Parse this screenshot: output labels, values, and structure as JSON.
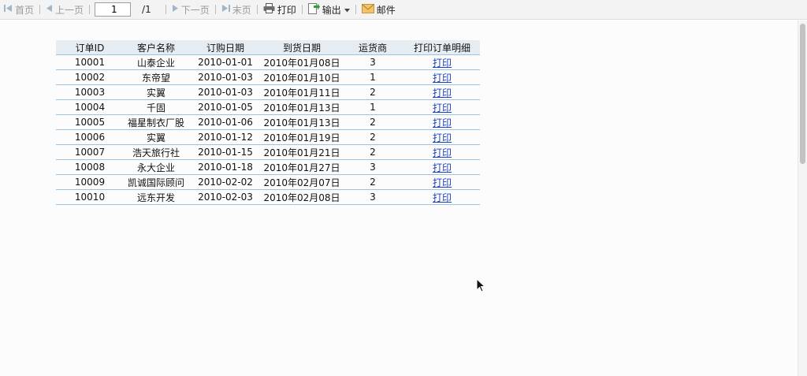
{
  "toolbar": {
    "first_label": "首页",
    "prev_label": "上一页",
    "page_value": "1",
    "page_total": "/1",
    "next_label": "下一页",
    "last_label": "末页",
    "print_label": "打印",
    "export_label": "输出",
    "mail_label": "邮件"
  },
  "table": {
    "headers": [
      "订单ID",
      "客户名称",
      "订购日期",
      "到货日期",
      "运货商",
      "打印订单明细"
    ],
    "rows": [
      [
        "10001",
        "山泰企业",
        "2010-01-01",
        "2010年01月08日",
        "3",
        "打印"
      ],
      [
        "10002",
        "东帝望",
        "2010-01-03",
        "2010年01月10日",
        "1",
        "打印"
      ],
      [
        "10003",
        "实翼",
        "2010-01-03",
        "2010年01月11日",
        "2",
        "打印"
      ],
      [
        "10004",
        "千固",
        "2010-01-05",
        "2010年01月13日",
        "1",
        "打印"
      ],
      [
        "10005",
        "福星制衣厂股",
        "2010-01-06",
        "2010年01月13日",
        "2",
        "打印"
      ],
      [
        "10006",
        "实翼",
        "2010-01-12",
        "2010年01月19日",
        "2",
        "打印"
      ],
      [
        "10007",
        "浩天旅行社",
        "2010-01-15",
        "2010年01月21日",
        "2",
        "打印"
      ],
      [
        "10008",
        "永大企业",
        "2010-01-18",
        "2010年01月27日",
        "3",
        "打印"
      ],
      [
        "10009",
        "凯诚国际顾问",
        "2010-02-02",
        "2010年02月07日",
        "2",
        "打印"
      ],
      [
        "10010",
        "远东开发",
        "2010-02-03",
        "2010年02月08日",
        "3",
        "打印"
      ]
    ]
  },
  "icons": {
    "first": "first-page-icon",
    "prev": "previous-page-icon",
    "next": "next-page-icon",
    "last": "last-page-icon",
    "print": "printer-icon",
    "export": "export-icon",
    "export_menu": "caret-down-icon",
    "mail": "mail-icon",
    "cursor": "mouse-pointer-icon"
  },
  "colors": {
    "toolbar_bg": "#f3f3f3",
    "header_bg": "#e6edf2",
    "row_border": "#9cc3e0",
    "link": "#1a3fc4",
    "disabled_text": "#9a9a9a"
  }
}
